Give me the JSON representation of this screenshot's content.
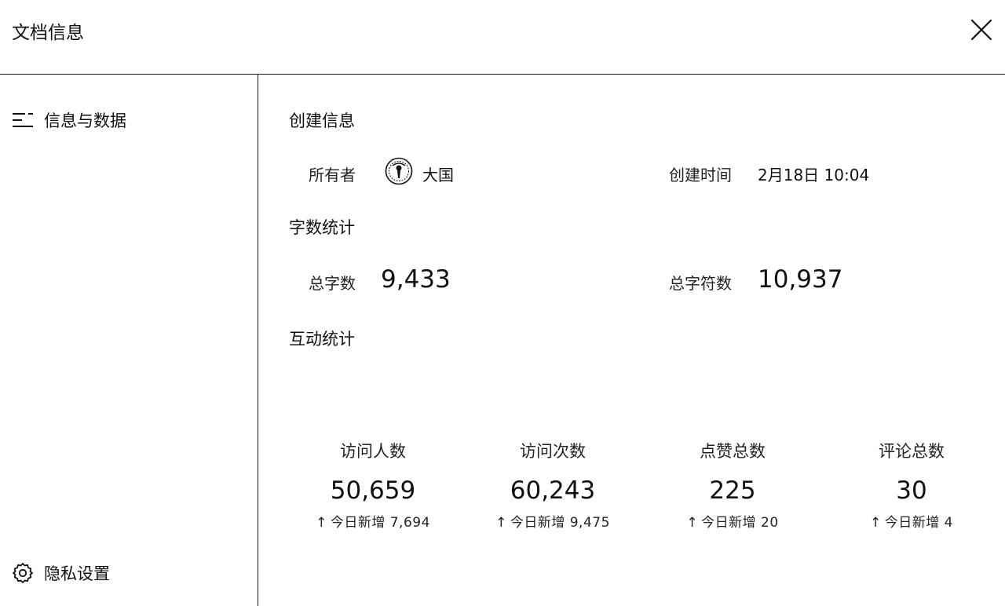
{
  "header": {
    "title": "文档信息",
    "close_icon": "close-icon"
  },
  "sidebar": {
    "items": [
      {
        "label": "信息与数据",
        "icon": "list-icon"
      },
      {
        "label": "隐私设置",
        "icon": "gear-icon"
      }
    ]
  },
  "main": {
    "create_section": {
      "title": "创建信息",
      "owner_label": "所有者",
      "owner_name": "大国",
      "created_label": "创建时间",
      "created_value": "2月18日 10:04"
    },
    "words_section": {
      "title": "字数统计",
      "total_words_label": "总字数",
      "total_words_value": "9,433",
      "total_chars_label": "总字符数",
      "total_chars_value": "10,937"
    },
    "interact_section": {
      "title": "互动统计",
      "stats": [
        {
          "label": "访问人数",
          "value": "50,659",
          "delta": "今日新增 7,694"
        },
        {
          "label": "访问次数",
          "value": "60,243",
          "delta": "今日新增 9,475"
        },
        {
          "label": "点赞总数",
          "value": "225",
          "delta": "今日新增 20"
        },
        {
          "label": "评论总数",
          "value": "30",
          "delta": "今日新增 4"
        }
      ]
    }
  }
}
